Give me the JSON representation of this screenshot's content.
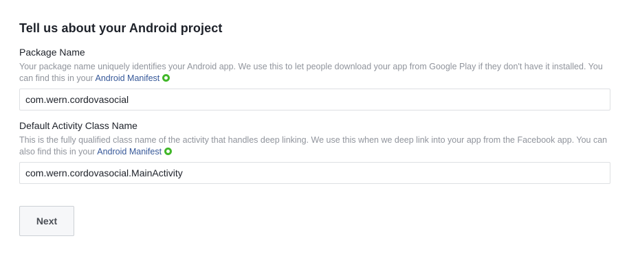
{
  "section": {
    "title": "Tell us about your Android project"
  },
  "package": {
    "label": "Package Name",
    "help_text": "Your package name uniquely identifies your Android app. We use this to let people download your app from Google Play if they don't have it installed. You can find this in your ",
    "link_text": "Android Manifest",
    "value": "com.wern.cordovasocial"
  },
  "activity": {
    "label": "Default Activity Class Name",
    "help_text": "This is the fully qualified class name of the activity that handles deep linking. We use this when we deep link into your app from the Facebook app. You can also find this in your ",
    "link_text": "Android Manifest",
    "value": "com.wern.cordovasocial.MainActivity"
  },
  "actions": {
    "next_label": "Next"
  },
  "colors": {
    "link": "#365899",
    "help_text": "#90949c",
    "indicator": "#42b72a",
    "button_bg": "#f6f7f9"
  },
  "icons": {
    "link_indicator": "green-ring-icon"
  }
}
